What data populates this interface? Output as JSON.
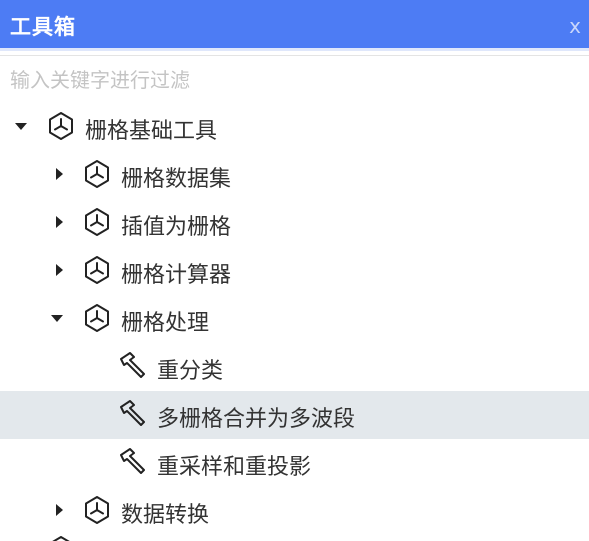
{
  "window": {
    "title": "工具箱",
    "close_label": "x"
  },
  "search": {
    "placeholder": "输入关键字进行过滤"
  },
  "tree": [
    {
      "label": "栅格基础工具",
      "type": "folder",
      "expanded": true,
      "level": 0
    },
    {
      "label": "栅格数据集",
      "type": "folder",
      "expanded": false,
      "level": 1
    },
    {
      "label": "插值为栅格",
      "type": "folder",
      "expanded": false,
      "level": 1
    },
    {
      "label": "栅格计算器",
      "type": "folder",
      "expanded": false,
      "level": 1
    },
    {
      "label": "栅格处理",
      "type": "folder",
      "expanded": true,
      "level": 1
    },
    {
      "label": "重分类",
      "type": "tool",
      "level": 2
    },
    {
      "label": "多栅格合并为多波段",
      "type": "tool",
      "level": 2,
      "selected": true
    },
    {
      "label": "重采样和重投影",
      "type": "tool",
      "level": 2
    },
    {
      "label": "数据转换",
      "type": "folder",
      "expanded": false,
      "level": 1
    }
  ]
}
